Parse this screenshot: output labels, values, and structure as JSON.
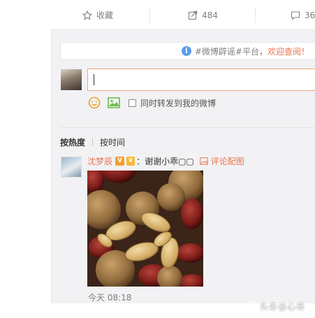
{
  "toolbar": {
    "favorite_label": "收藏",
    "forward_count": "484",
    "comment_count": "36"
  },
  "notice": {
    "prefix": "#微博辟谣#平台，",
    "highlight": "欢迎查阅！"
  },
  "composer": {
    "input_value": "",
    "forward_checkbox_label": "同时转发到我的微博"
  },
  "sort": {
    "hot_label": "按热度",
    "time_label": "按时间"
  },
  "comment": {
    "username": "沈梦辰",
    "text": "：谢谢小乖▢▢",
    "pic_label": "评论配图",
    "time": "今天 08:18"
  },
  "watermark": {
    "text": "头条@心尋"
  },
  "colors": {
    "accent": "#eb7350",
    "info": "#5d9cec",
    "muted": "#808080",
    "panel_bg": "#f2f2f5"
  }
}
